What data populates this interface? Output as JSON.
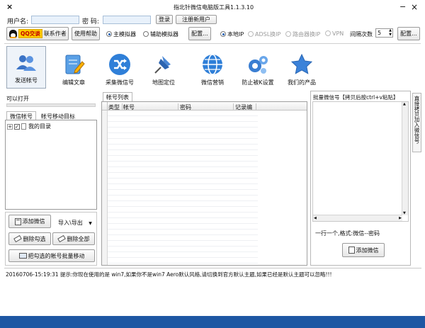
{
  "window": {
    "title": "指北针微信电脑版工具1.1.3.10",
    "close_glyph": "×",
    "min_glyph": "−"
  },
  "login": {
    "username_label": "用户名:",
    "password_label": "密  码:",
    "login_button": "登录",
    "register_button": "注册新用户"
  },
  "row2": {
    "qq_badge": "QQ交谈",
    "contact_author": "联系作者",
    "help_button": "使用帮助",
    "sim_main": "主模拟器",
    "sim_aux": "辅助模拟器",
    "config1": "配置...",
    "ip_local": "本地IP",
    "ip_adsl": "ADSL换IP",
    "ip_router": "路由器换IP",
    "ip_vpn": "VPN",
    "interval_label": "间隔次数",
    "interval_value": "5",
    "config2": "配置..."
  },
  "toolbar": {
    "items": [
      {
        "label": "发送帐号"
      },
      {
        "label": "编辑文章"
      },
      {
        "label": "采集微信号"
      },
      {
        "label": "地图定位"
      },
      {
        "label": "微信营销"
      },
      {
        "label": "防止被K设置"
      },
      {
        "label": "我们的产品"
      }
    ]
  },
  "left": {
    "status_text": "可以打开",
    "tab_wechat": "微信帐号",
    "tab_move": "帐号移动目标",
    "tree_root": "我的目录",
    "tree_expander": "+",
    "add_wechat": "添加微信",
    "import_export": "导入\\导出",
    "delete_checked": "删除勾选",
    "delete_all": "删除全部",
    "batch_move": "把勾选的帐号批量移动"
  },
  "middle": {
    "tab_label": "帐号列表",
    "columns": [
      "类型",
      "帐号",
      "密码",
      "记录编号"
    ]
  },
  "right": {
    "header": "批量微信号【拷贝后按ctrl+v粘贴】",
    "side_tab": "直接拷贝加入微信号",
    "hint": "一行一个,格式:微信--密码",
    "add_wechat": "添加微信"
  },
  "log": {
    "line": "20160706-15:19:31  提示:你现在使用的是 win7,如果你不是win7 Aero默认风格,请切换到官方默认主题,如果已经是默认主题可以忽略!!!"
  },
  "colors": {
    "accent": "#1a5fb4",
    "footer": "#1d57a3",
    "qq_yellow": "#ffcc00"
  }
}
